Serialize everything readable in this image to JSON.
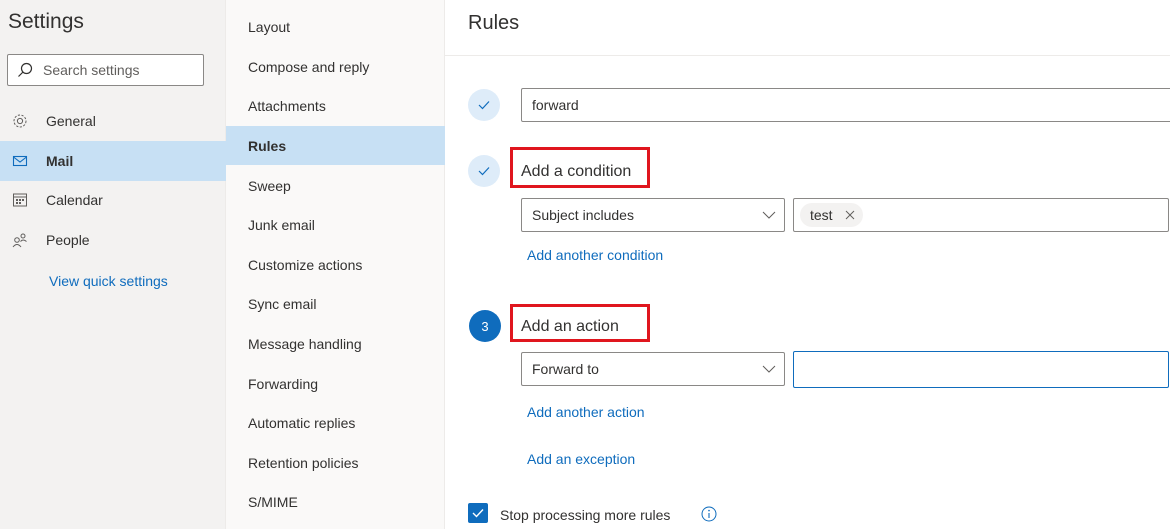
{
  "settings": {
    "title": "Settings",
    "search_placeholder": "Search settings",
    "categories": [
      {
        "label": "General",
        "icon": "gear-icon"
      },
      {
        "label": "Mail",
        "icon": "mail-icon"
      },
      {
        "label": "Calendar",
        "icon": "calendar-icon"
      },
      {
        "label": "People",
        "icon": "people-icon"
      }
    ],
    "active_category": "Mail",
    "quick_settings_link": "View quick settings"
  },
  "mail_nav": {
    "items": [
      "Layout",
      "Compose and reply",
      "Attachments",
      "Rules",
      "Sweep",
      "Junk email",
      "Customize actions",
      "Sync email",
      "Message handling",
      "Forwarding",
      "Automatic replies",
      "Retention policies",
      "S/MIME"
    ],
    "active": "Rules"
  },
  "rules": {
    "title": "Rules",
    "rule_name": "forward",
    "condition": {
      "heading": "Add a condition",
      "type": "Subject includes",
      "chip": "test",
      "add_link": "Add another condition"
    },
    "action": {
      "step_number": "3",
      "heading": "Add an action",
      "type": "Forward to",
      "target": "",
      "add_link": "Add another action"
    },
    "exception_link": "Add an exception",
    "stop_processing": {
      "label": "Stop processing more rules",
      "checked": true
    }
  },
  "colors": {
    "accent": "#0f6cbd",
    "selected_bg": "#c7e0f4",
    "highlight_box": "#e0161e"
  }
}
